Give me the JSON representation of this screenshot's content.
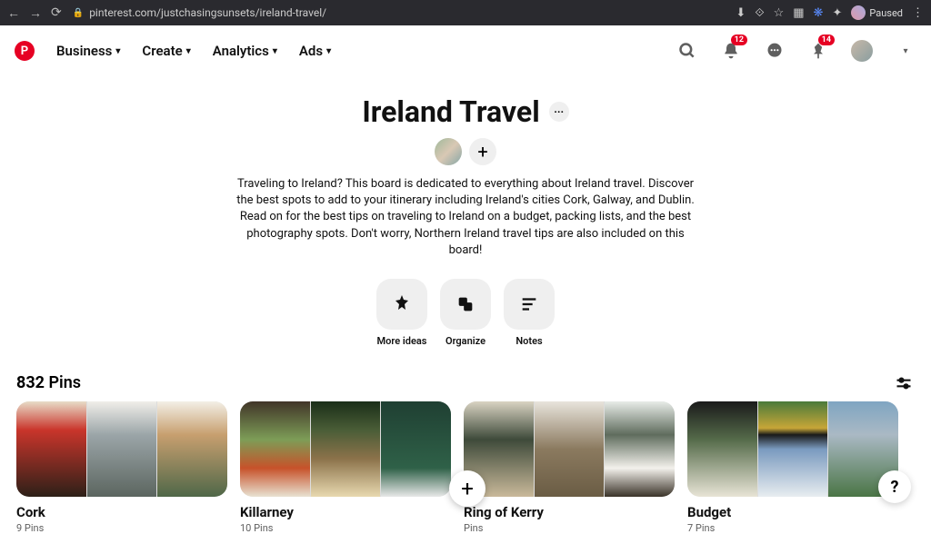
{
  "browser": {
    "url": "pinterest.com/justchasingsunsets/ireland-travel/",
    "profile_state": "Paused"
  },
  "nav": {
    "business": "Business",
    "create": "Create",
    "analytics": "Analytics",
    "ads": "Ads"
  },
  "badges": {
    "notif": "12",
    "pin": "14"
  },
  "board": {
    "title": "Ireland Travel",
    "description": "Traveling to Ireland? This board is dedicated to everything about Ireland travel. Discover the best spots to add to your itinerary including Ireland's cities Cork, Galway, and Dublin. Read on for the best tips on traveling to Ireland on a budget, packing lists, and the best photography spots. Don't worry, Northern Ireland travel tips are also included on this board!",
    "pin_count": "832",
    "pin_label": "Pins"
  },
  "actions": {
    "more_ideas": "More ideas",
    "organize": "Organize",
    "notes": "Notes"
  },
  "sections": [
    {
      "name": "Cork",
      "pins": "9 Pins"
    },
    {
      "name": "Killarney",
      "pins": "10 Pins"
    },
    {
      "name": "Ring of Kerry",
      "pins": "Pins"
    },
    {
      "name": "Budget",
      "pins": "7 Pins"
    }
  ],
  "help": "?"
}
